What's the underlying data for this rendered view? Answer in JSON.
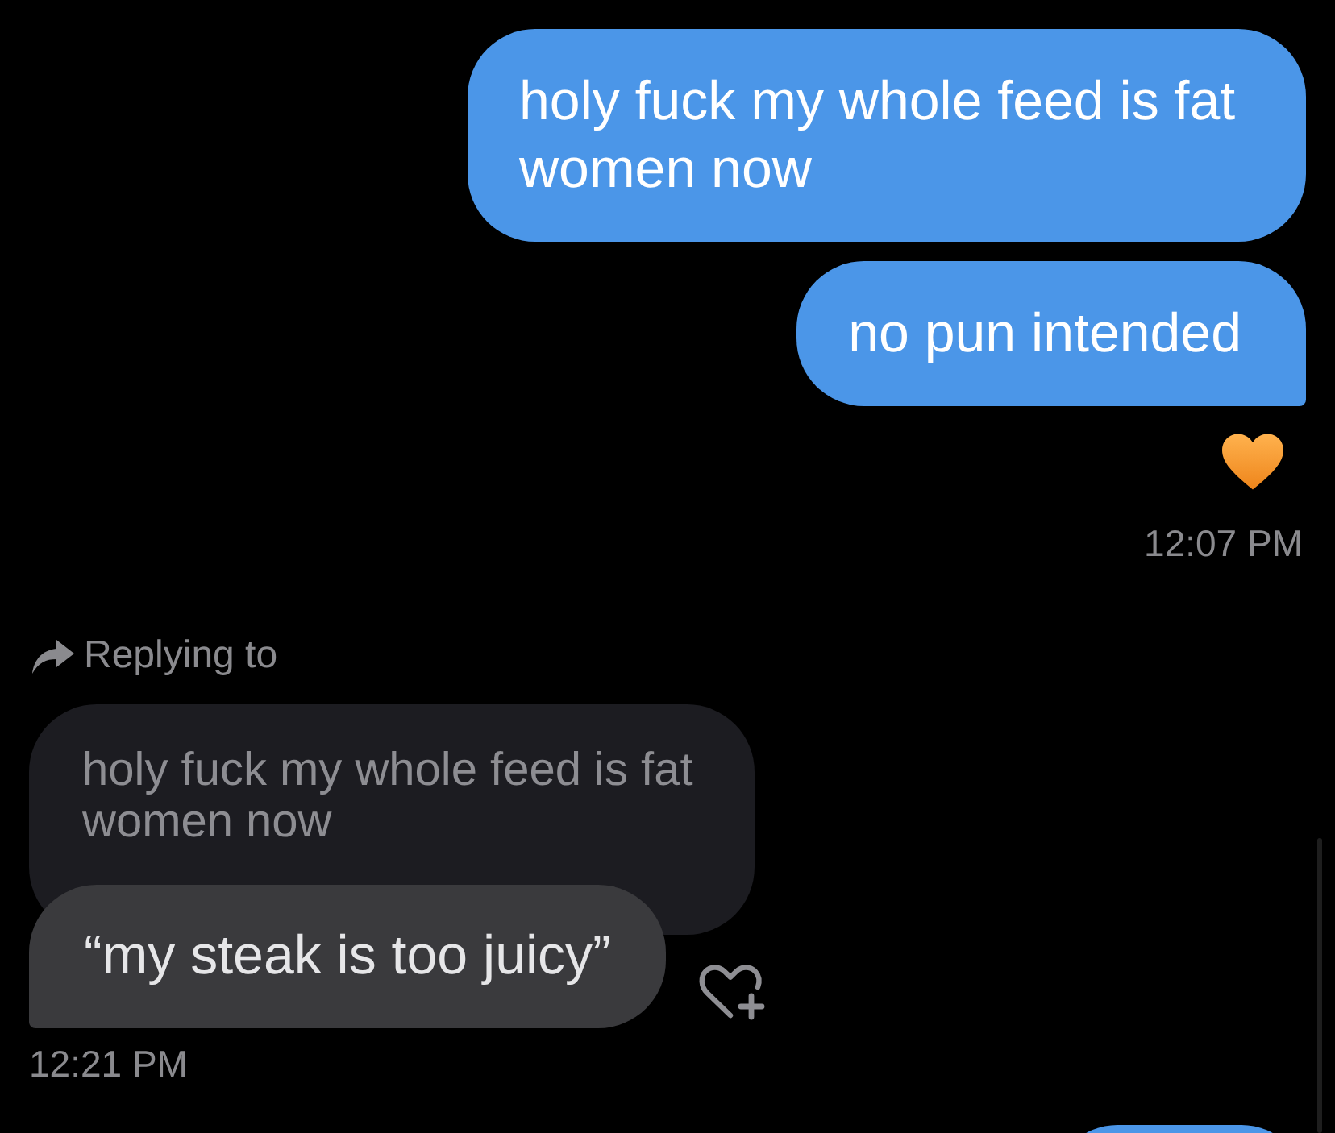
{
  "outgoing": {
    "messages": [
      {
        "text": "holy fuck my whole feed is fat women now",
        "tail": false
      },
      {
        "text": "no pun intended",
        "tail": true
      }
    ],
    "reacted": true,
    "time": "12:07 PM"
  },
  "incoming": {
    "reply_label": "Replying to",
    "quoted_text": "holy fuck my whole feed is fat women now",
    "messages": [
      {
        "text": "“my steak is too juicy”",
        "tail": true
      }
    ],
    "reacted": false,
    "time": "12:21 PM"
  },
  "partial_next_bubble": true
}
